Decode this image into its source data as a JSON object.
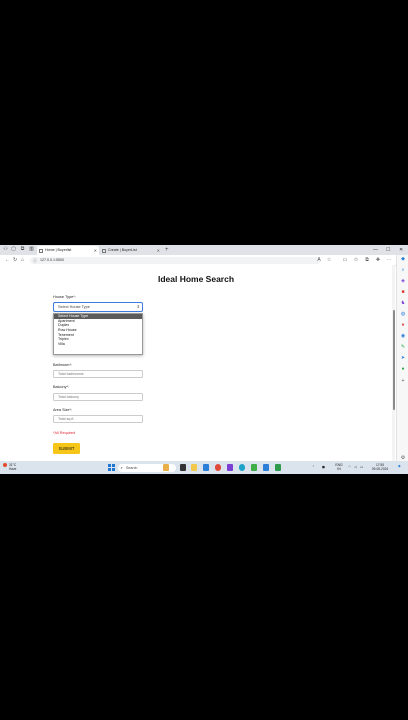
{
  "browser": {
    "tabs": [
      {
        "label": "Home | Buyerlist",
        "active": true
      },
      {
        "label": "Create | BuyerList",
        "active": false
      }
    ],
    "url": "127.0.0.1:5500",
    "window_controls": [
      "—",
      "☐",
      "✕"
    ]
  },
  "page": {
    "title": "Ideal Home Search",
    "house_type": {
      "label": "House Type*:",
      "selected": "Select House Type",
      "options": [
        "Select House Type",
        "Apartment",
        "Duplex",
        "Row House",
        "Tenement",
        "Triplex",
        "Villa"
      ]
    },
    "bathroom": {
      "label": "Bathroom*:",
      "placeholder": "Total bathrooms"
    },
    "balcony": {
      "label": "Balcony*:",
      "placeholder": "Total balcony"
    },
    "area": {
      "label": "Area Size*:",
      "placeholder": "Total sq.ft."
    },
    "required_note": "*All Required",
    "submit_label": "SUBMIT"
  },
  "taskbar": {
    "weather_temp": "31°C",
    "weather_desc": "Haze",
    "search_placeholder": "Search",
    "lang_top": "ENG",
    "lang_bottom": "IN",
    "time": "17:55",
    "date": "09-05-2024"
  },
  "colors": {
    "submit": "#f5c518",
    "required": "#d9252f",
    "focus_border": "#3b7be0",
    "highlight": "#5b5b5b"
  }
}
